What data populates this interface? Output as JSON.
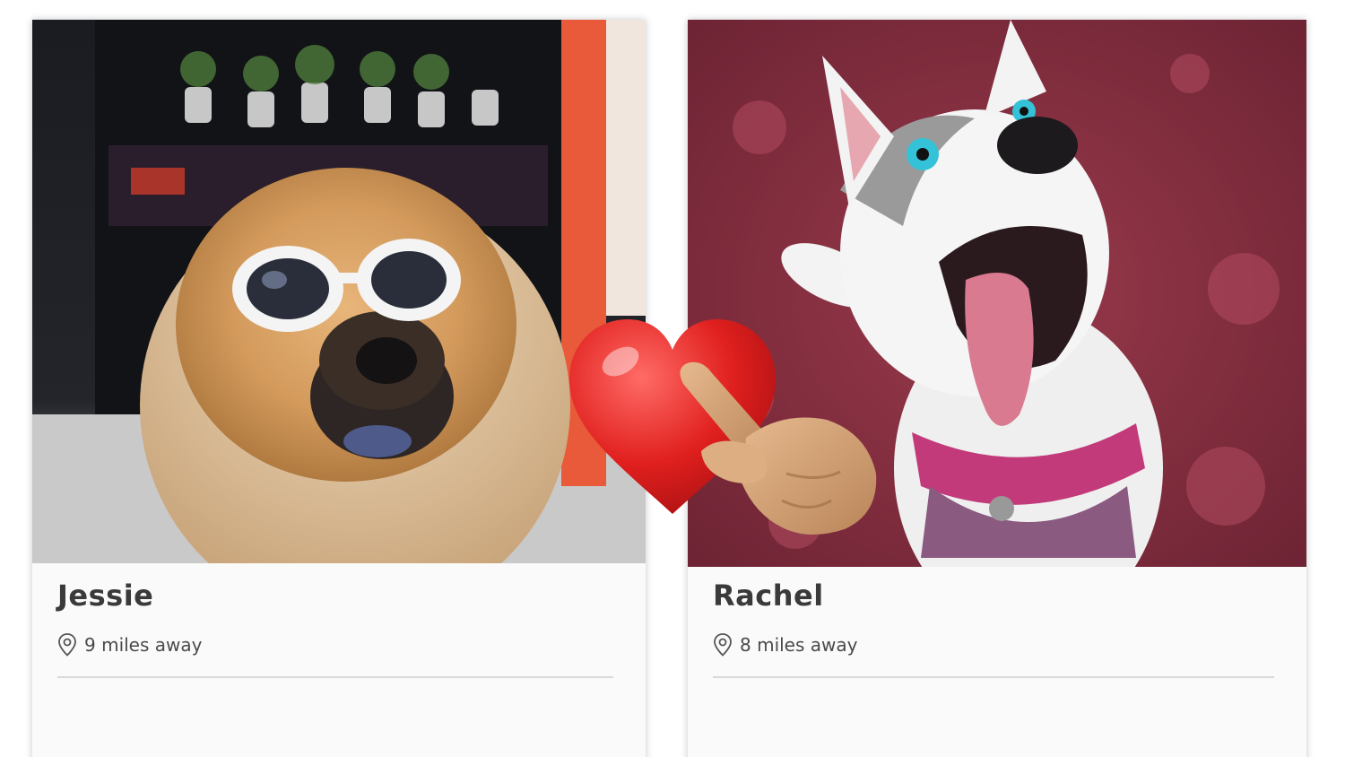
{
  "profiles": [
    {
      "name": "Jessie",
      "distance": "9 miles away",
      "photo_icon": "dog-photo-sunglasses"
    },
    {
      "name": "Rachel",
      "distance": "8 miles away",
      "photo_icon": "dog-photo-husky"
    }
  ],
  "overlay": {
    "heart_icon": "heart-emoji",
    "hand_icon": "pointing-hand-emoji"
  },
  "colors": {
    "heart": "#e0201e",
    "hand": "#d6a67a",
    "name_text": "#3a3a3a",
    "divider": "#d8d8d8"
  }
}
